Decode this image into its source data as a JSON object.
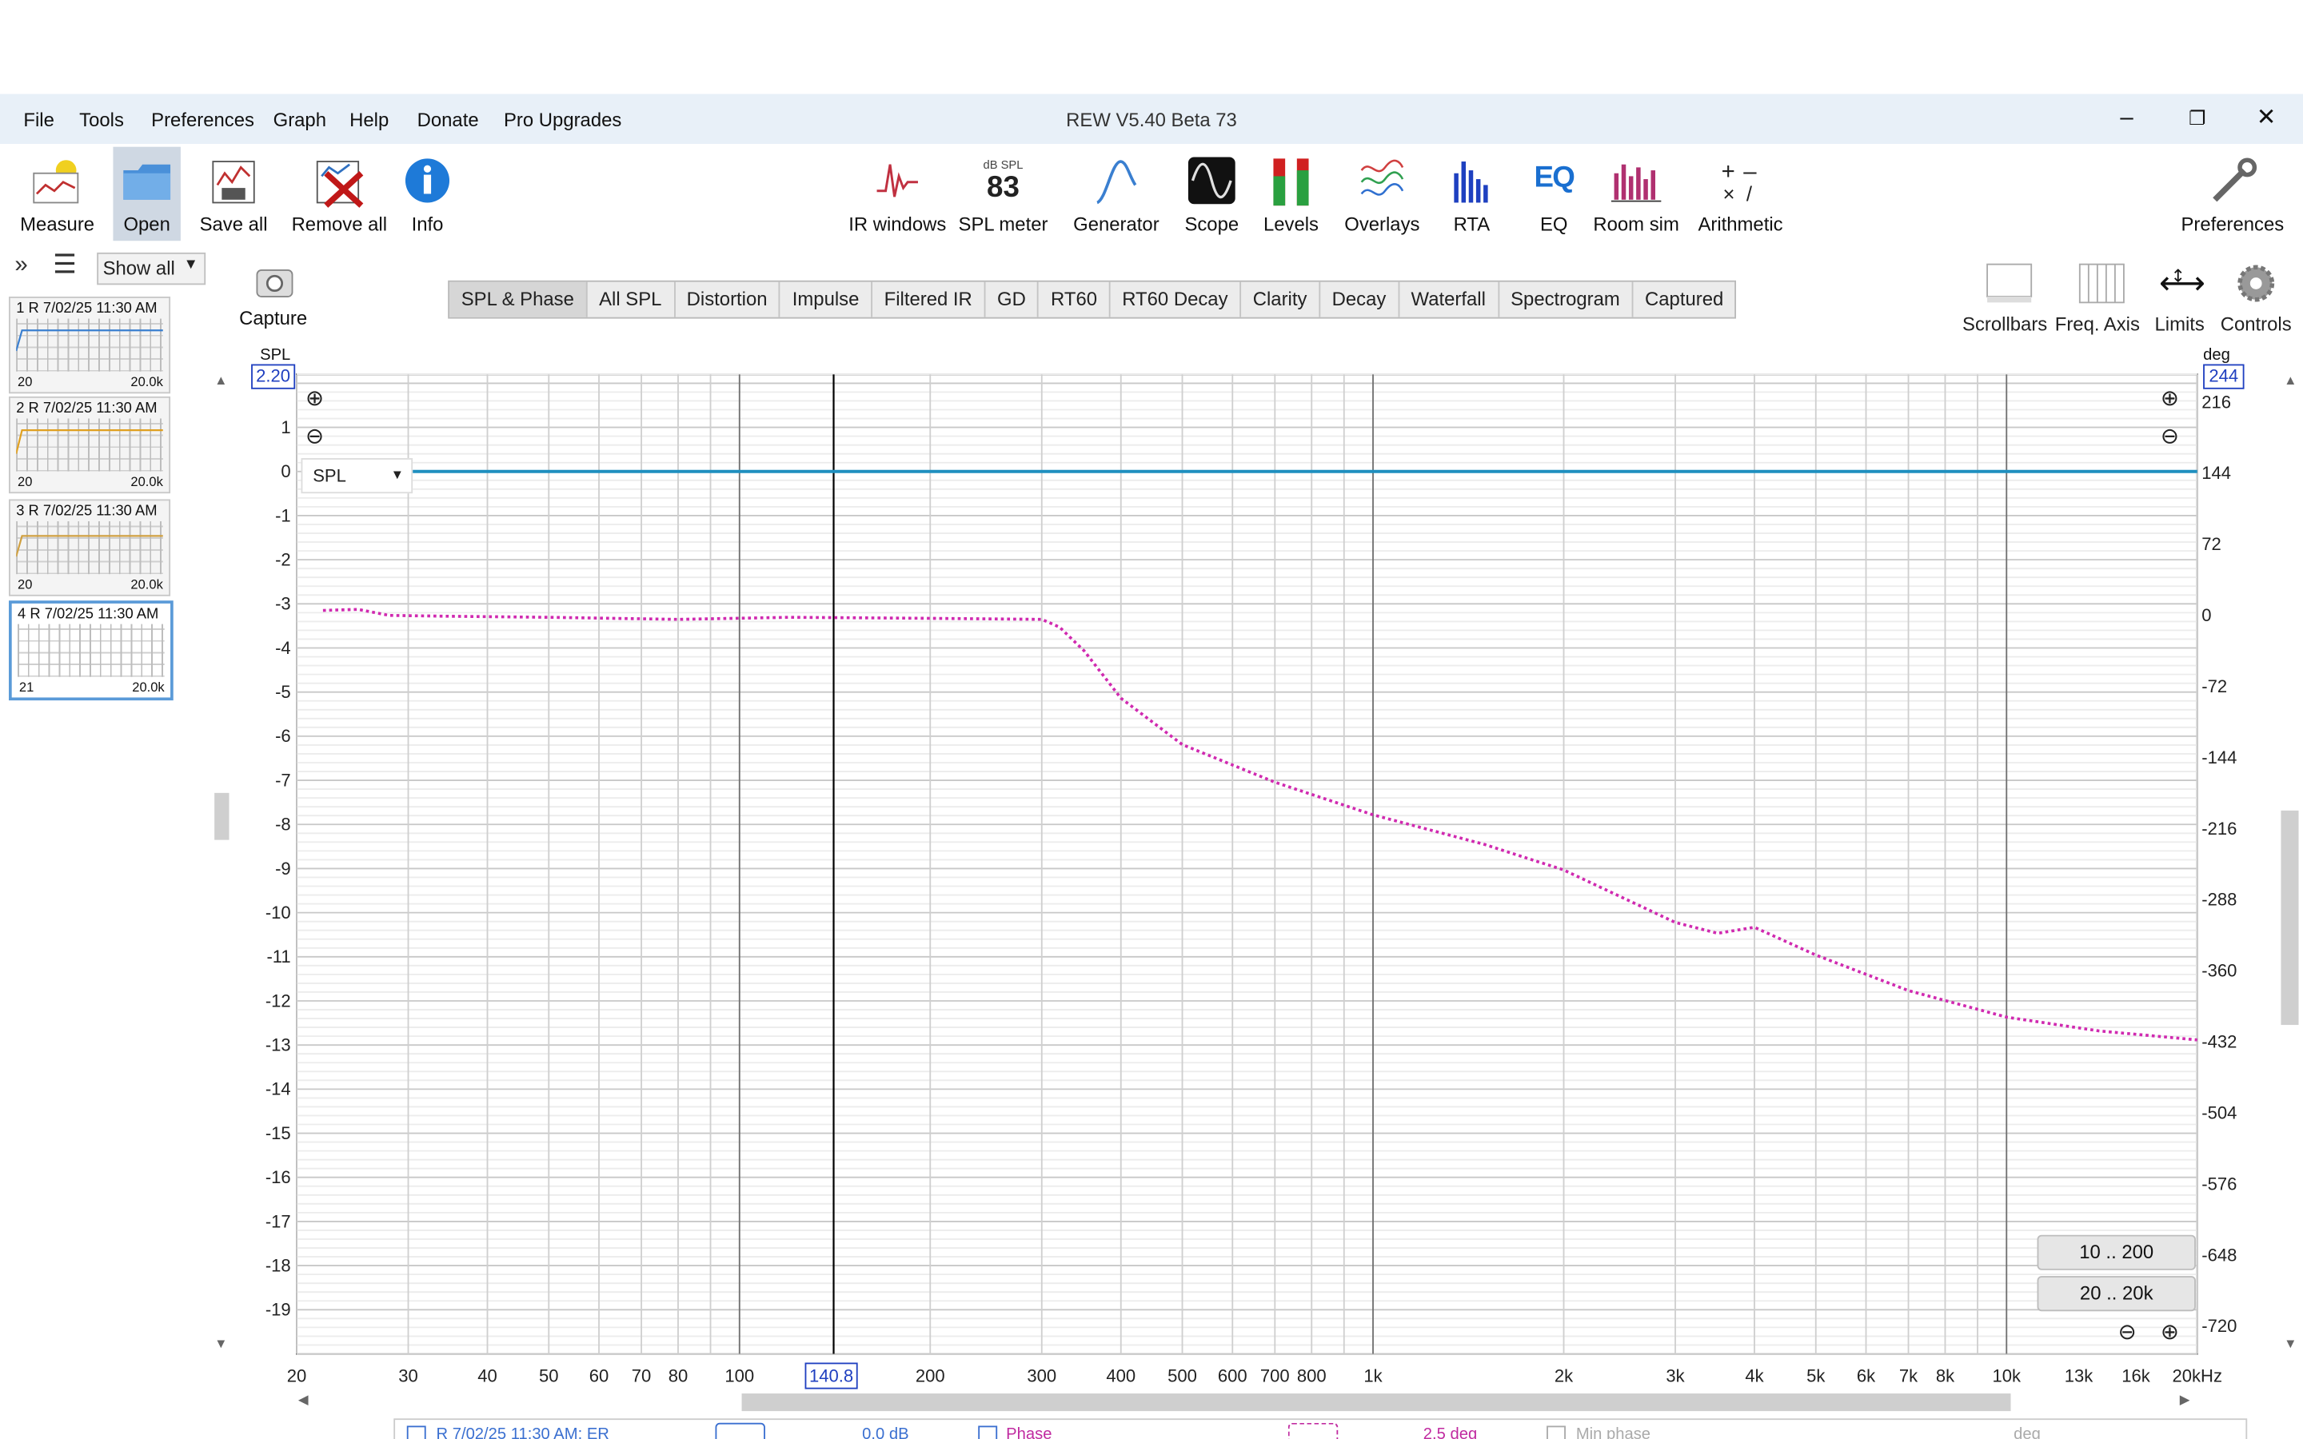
{
  "window": {
    "title": "REW V5.40 Beta 73"
  },
  "menu": {
    "file": "File",
    "tools": "Tools",
    "preferences": "Preferences",
    "graph": "Graph",
    "help": "Help",
    "donate": "Donate",
    "pro_upgrades": "Pro Upgrades"
  },
  "toolbar_left": {
    "measure": "Measure",
    "open": "Open",
    "save_all": "Save all",
    "remove_all": "Remove all",
    "info": "Info"
  },
  "toolbar_center": {
    "ir_windows": "IR windows",
    "spl_meter": "SPL meter",
    "spl_meter_top": "dB SPL",
    "spl_meter_value": "83",
    "generator": "Generator",
    "scope": "Scope",
    "levels": "Levels",
    "overlays": "Overlays",
    "rta": "RTA",
    "eq": "EQ",
    "eq_glyph": "EQ",
    "room_sim": "Room sim",
    "arithmetic": "Arithmetic"
  },
  "toolbar_right": {
    "preferences": "Preferences"
  },
  "list_controls": {
    "show_all": "Show all",
    "capture": "Capture"
  },
  "measurements": [
    {
      "title": "1 R 7/02/25 11:30 AM",
      "fmin": "20",
      "fmax": "20.0k",
      "color": "#3a7fd0"
    },
    {
      "title": "2 R 7/02/25 11:30 AM",
      "fmin": "20",
      "fmax": "20.0k",
      "color": "#e0a020"
    },
    {
      "title": "3 R 7/02/25 11:30 AM",
      "fmin": "20",
      "fmax": "20.0k",
      "color": "#d0a040"
    },
    {
      "title": "4 R 7/02/25 11:30 AM",
      "fmin": "21",
      "fmax": "20.0k",
      "color": "#3a7fd0"
    }
  ],
  "tabs": [
    "SPL & Phase",
    "All SPL",
    "Distortion",
    "Impulse",
    "Filtered IR",
    "GD",
    "RT60",
    "RT60 Decay",
    "Clarity",
    "Decay",
    "Waterfall",
    "Spectrogram",
    "Captured"
  ],
  "active_tab": "SPL & Phase",
  "graph_controls": {
    "scrollbars": "Scrollbars",
    "freq_axis": "Freq. Axis",
    "limits": "Limits",
    "controls": "Controls"
  },
  "graph": {
    "left_unit": "SPL",
    "right_unit": "deg",
    "left_top_value": "2.20",
    "right_top_value": "244",
    "curve_select": "SPL",
    "cursor_freq": "140.8",
    "range_buttons": [
      "10 .. 200",
      "20 .. 20k"
    ],
    "colors": {
      "spl": "#1f8fbf",
      "phase": "#d02ab0",
      "cursor": "#000000"
    }
  },
  "legend_row": {
    "measurement": "R 7/02/25 11:30 AM: ER",
    "offset": "0.0 dB",
    "phase": "Phase",
    "phase_value": "2.5 deg",
    "min_phase": "Min phase",
    "unit": "deg"
  },
  "chart_data": {
    "type": "line",
    "x_scale": "log",
    "x_ticks": [
      "20",
      "30",
      "40",
      "50",
      "60",
      "70",
      "80",
      "100",
      "140.8",
      "200",
      "300",
      "400",
      "500",
      "600",
      "700",
      "800",
      "1k",
      "2k",
      "3k",
      "4k",
      "5k",
      "6k",
      "7k",
      "8k",
      "10k",
      "13k",
      "16k",
      "20kHz"
    ],
    "y_left_ticks": [
      "1",
      "0",
      "-1",
      "-2",
      "-3",
      "-4",
      "-5",
      "-6",
      "-7",
      "-8",
      "-9",
      "-10",
      "-11",
      "-12",
      "-13",
      "-14",
      "-15",
      "-16",
      "-17",
      "-18",
      "-19"
    ],
    "y_right_ticks": [
      "216",
      "144",
      "72",
      "0",
      "-72",
      "-144",
      "-216",
      "-288",
      "-360",
      "-432",
      "-504",
      "-576",
      "-648",
      "-720"
    ],
    "ylim_left": [
      -20.0,
      2.2
    ],
    "ylim_right": [
      -748,
      244
    ],
    "xlim": [
      20,
      20000
    ],
    "series": [
      {
        "name": "SPL",
        "axis": "left",
        "x": [
          30,
          20000
        ],
        "y": [
          0,
          0
        ]
      },
      {
        "name": "Phase",
        "axis": "right",
        "x": [
          22,
          25,
          28,
          35,
          50,
          80,
          120,
          200,
          300,
          320,
          350,
          400,
          500,
          700,
          1000,
          1500,
          2000,
          3000,
          3500,
          4000,
          5000,
          7000,
          10000,
          14000,
          20000
        ],
        "y": [
          5,
          6,
          0,
          -1,
          -2,
          -4,
          -2,
          -3,
          -4,
          -12,
          -36,
          -84,
          -131,
          -169,
          -202,
          -232,
          -258,
          -311,
          -322,
          -316,
          -344,
          -380,
          -407,
          -421,
          -430
        ]
      }
    ]
  }
}
